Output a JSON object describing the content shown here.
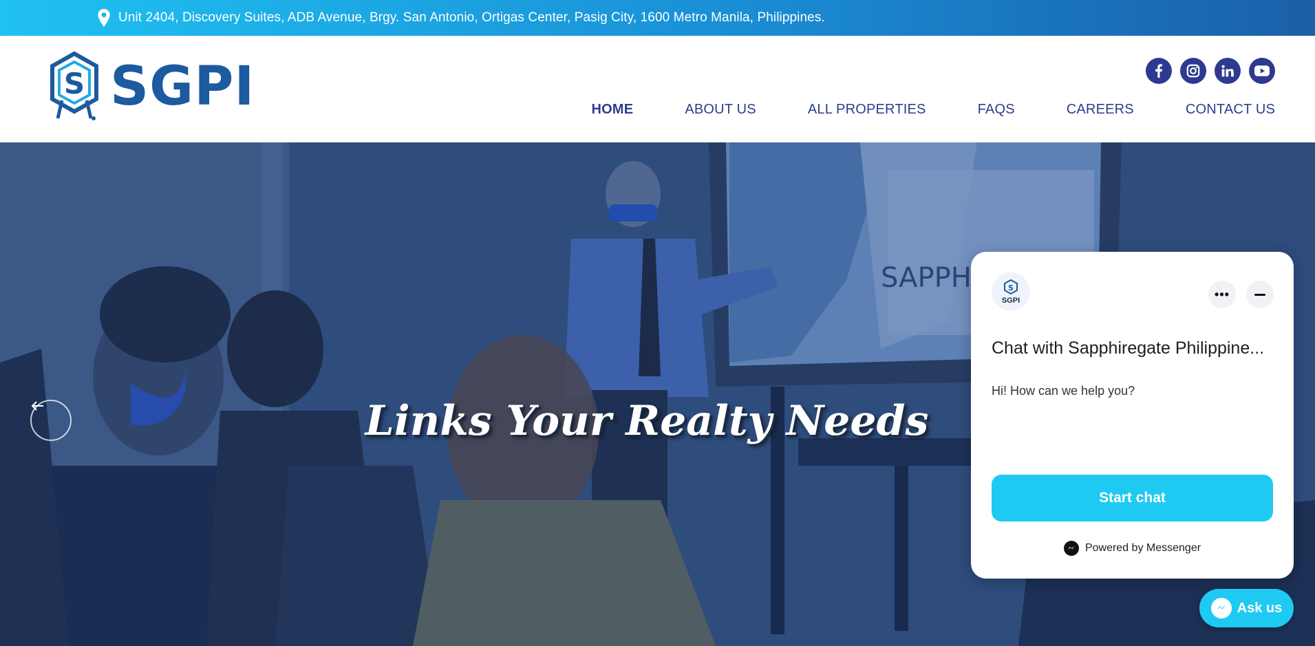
{
  "topbar": {
    "address": "Unit 2404, Discovery Suites, ADB Avenue, Brgy. San Antonio, Ortigas Center, Pasig City, 1600 Metro Manila, Philippines.",
    "icon": "location-pin-icon"
  },
  "header": {
    "logo_text": "SGPI",
    "social": [
      {
        "name": "facebook-icon",
        "glyph": "f"
      },
      {
        "name": "instagram-icon",
        "glyph": ""
      },
      {
        "name": "linkedin-icon",
        "glyph": "in"
      },
      {
        "name": "youtube-icon",
        "glyph": ""
      }
    ],
    "nav": [
      {
        "label": "HOME",
        "active": true
      },
      {
        "label": "ABOUT US",
        "active": false
      },
      {
        "label": "ALL PROPERTIES",
        "active": false
      },
      {
        "label": "FAQS",
        "active": false
      },
      {
        "label": "CAREERS",
        "active": false
      },
      {
        "label": "CONTACT US",
        "active": false
      }
    ]
  },
  "hero": {
    "title": "Links Your Realty Needs",
    "prev_icon": "arrow-left-icon"
  },
  "chat": {
    "avatar_text": "SGPI",
    "title": "Chat with Sapphiregate Philippine...",
    "message": "Hi! How can we help you?",
    "start_label": "Start chat",
    "powered_by": "Powered by Messenger"
  },
  "askus": {
    "label": "Ask us"
  },
  "colors": {
    "brand_blue": "#1d5a9f",
    "nav_color": "#2f3d8c",
    "messenger_cyan": "#1fcaf2"
  }
}
